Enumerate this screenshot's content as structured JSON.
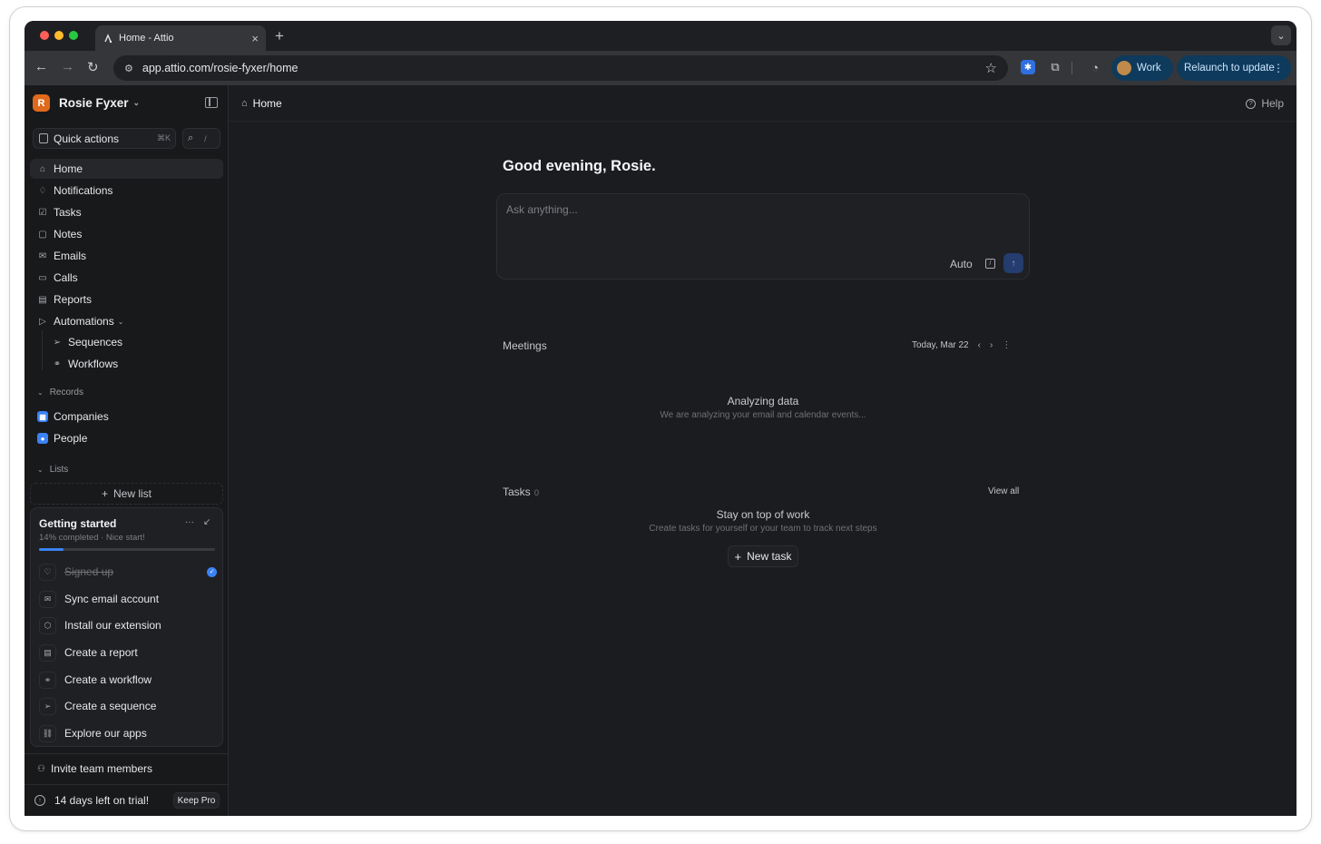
{
  "browser": {
    "tab_title": "Home - Attio",
    "tab_close": "×",
    "new_tab": "+",
    "url": "app.attio.com/rosie-fyxer/home",
    "profile_label": "Work",
    "relaunch_label": "Relaunch to update",
    "traffic_colors": [
      "#ff5f57",
      "#febc2e",
      "#28c840"
    ]
  },
  "sidebar": {
    "workspace_name": "Rosie Fyxer",
    "workspace_initial": "R",
    "quick_actions": "Quick actions",
    "quick_actions_kbd": "⌘K",
    "search_kbd": "/",
    "nav": [
      {
        "label": "Home",
        "icon": "home-icon"
      },
      {
        "label": "Notifications",
        "icon": "bell-icon"
      },
      {
        "label": "Tasks",
        "icon": "checkbox-icon"
      },
      {
        "label": "Notes",
        "icon": "note-icon"
      },
      {
        "label": "Emails",
        "icon": "mail-icon"
      },
      {
        "label": "Calls",
        "icon": "video-icon"
      },
      {
        "label": "Reports",
        "icon": "report-icon"
      },
      {
        "label": "Automations",
        "icon": "play-icon"
      }
    ],
    "automations_sub": [
      {
        "label": "Sequences",
        "icon": "send-icon"
      },
      {
        "label": "Workflows",
        "icon": "workflow-icon"
      }
    ],
    "records_heading": "Records",
    "records": [
      {
        "label": "Companies",
        "icon": "building-icon",
        "color": "#3b82f6"
      },
      {
        "label": "People",
        "icon": "person-icon",
        "color": "#3b82f6"
      }
    ],
    "lists_heading": "Lists",
    "new_list": "New list",
    "getting_started": {
      "title": "Getting started",
      "subtitle": "14% completed · Nice start!",
      "progress": 0.14,
      "items": [
        {
          "label": "Signed up",
          "icon": "heart-icon",
          "done": true
        },
        {
          "label": "Sync email account",
          "icon": "mail-icon",
          "done": false
        },
        {
          "label": "Install our extension",
          "icon": "puzzle-icon",
          "done": false
        },
        {
          "label": "Create a report",
          "icon": "report-icon",
          "done": false
        },
        {
          "label": "Create a workflow",
          "icon": "workflow-icon",
          "done": false
        },
        {
          "label": "Create a sequence",
          "icon": "send-icon",
          "done": false
        },
        {
          "label": "Explore our apps",
          "icon": "link-icon",
          "done": false
        }
      ]
    },
    "invite": "Invite team members",
    "trial": "14 days left on trial!",
    "keep_pro": "Keep Pro"
  },
  "main": {
    "breadcrumb": "Home",
    "help": "Help",
    "greeting": "Good evening, Rosie.",
    "ask_placeholder": "Ask anything...",
    "ask_mode": "Auto",
    "meetings": {
      "label": "Meetings",
      "date": "Today, Mar 22",
      "empty_title": "Analyzing data",
      "empty_sub": "We are analyzing your email and calendar events..."
    },
    "tasks": {
      "label": "Tasks",
      "count": "0",
      "view_all": "View all",
      "empty_title": "Stay on top of work",
      "empty_sub": "Create tasks for yourself or your team to track next steps",
      "new_task": "New task"
    }
  }
}
